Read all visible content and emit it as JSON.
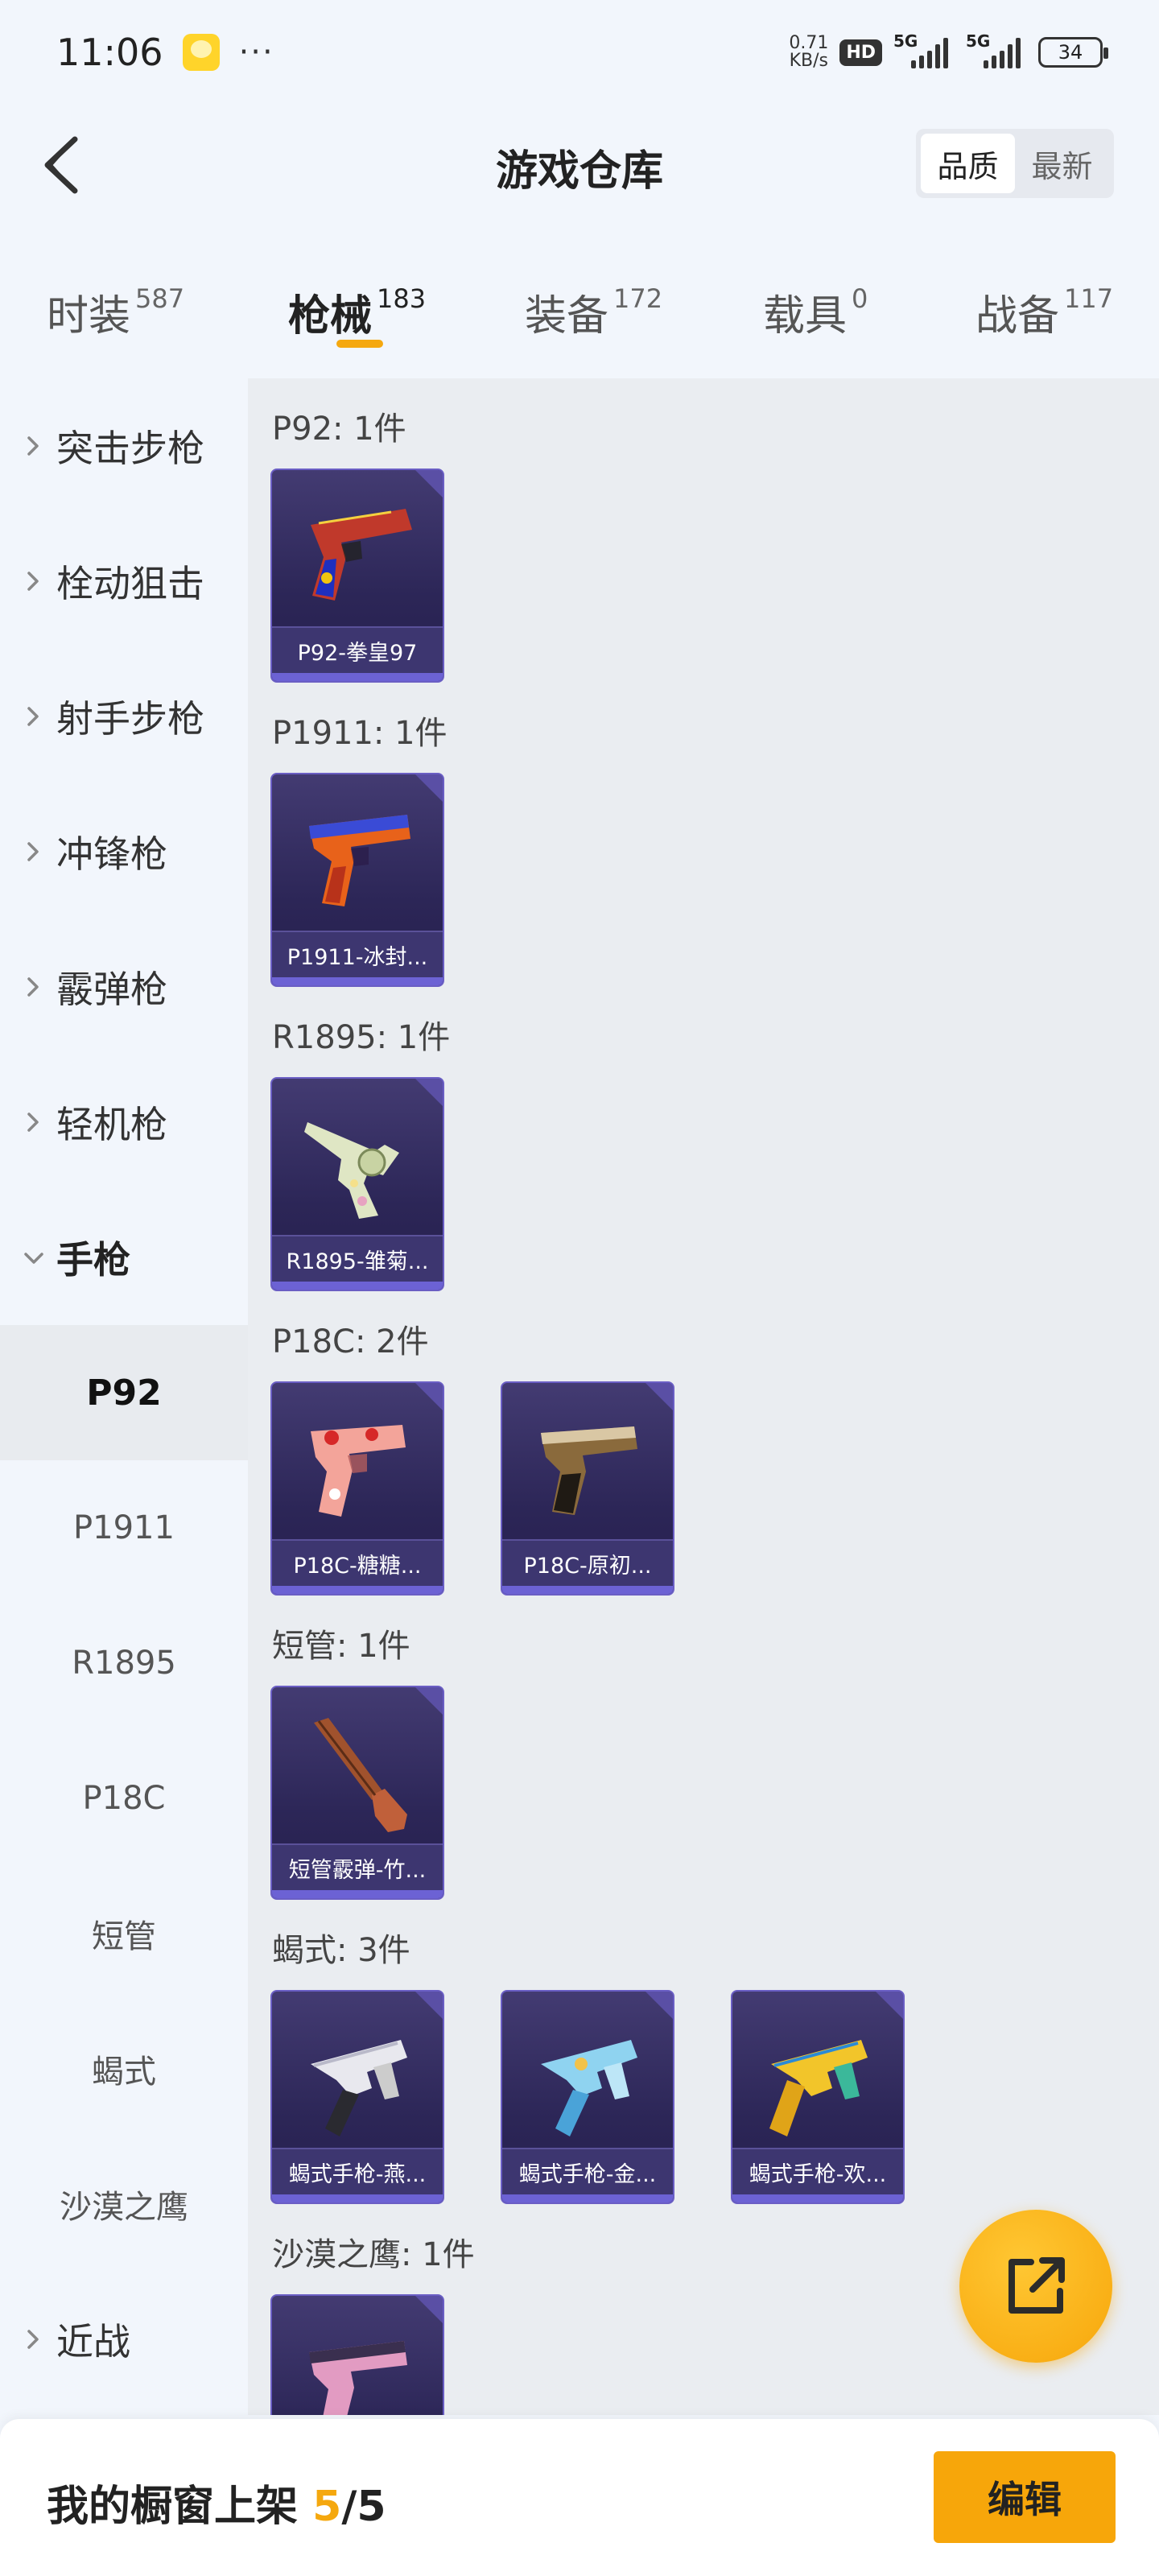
{
  "status_bar": {
    "time": "11:06",
    "more": "···",
    "net_speed_value": "0.71",
    "net_speed_unit": "KB/s",
    "hd": "HD",
    "signal1": "5G",
    "signal2": "5G",
    "battery": "34"
  },
  "header": {
    "title": "游戏仓库",
    "sort_options": [
      "品质",
      "最新"
    ],
    "active_sort": "品质"
  },
  "category_tabs": [
    {
      "label": "时装",
      "count": "587"
    },
    {
      "label": "枪械",
      "count": "183",
      "active": true
    },
    {
      "label": "装备",
      "count": "172"
    },
    {
      "label": "载具",
      "count": "0"
    },
    {
      "label": "战备",
      "count": "117"
    }
  ],
  "sidebar": {
    "groups": [
      "突击步枪",
      "栓动狙击",
      "射手步枪",
      "冲锋枪",
      "霰弹枪",
      "轻机枪",
      "手枪",
      "近战"
    ],
    "expanded_group": "手枪",
    "subitems": [
      "P92",
      "P1911",
      "R1895",
      "P18C",
      "短管",
      "蝎式",
      "沙漠之鹰"
    ],
    "active_subitem": "P92"
  },
  "sections": [
    {
      "title": "P92: 1件",
      "items": [
        "P92-拳皇97"
      ]
    },
    {
      "title": "P1911: 1件",
      "items": [
        "P1911-冰封..."
      ]
    },
    {
      "title": "R1895: 1件",
      "items": [
        "R1895-雏菊..."
      ]
    },
    {
      "title": "P18C: 2件",
      "items": [
        "P18C-糖糖...",
        "P18C-原初..."
      ]
    },
    {
      "title": "短管: 1件",
      "items": [
        "短管霰弹-竹..."
      ]
    },
    {
      "title": "蝎式: 3件",
      "items": [
        "蝎式手枪-燕...",
        "蝎式手枪-金...",
        "蝎式手枪-欢..."
      ]
    },
    {
      "title": "沙漠之鹰: 1件",
      "items": [
        ""
      ]
    }
  ],
  "bottom_bar": {
    "showcase_label": "我的橱窗上架",
    "showcase_current": "5",
    "showcase_sep": "/",
    "showcase_total": "5",
    "edit_label": "编辑"
  },
  "colors": {
    "accent": "#f5a80f",
    "card_bg": "#2c2657",
    "card_border": "#6a5ec4",
    "content_bg": "#eaedf1",
    "sidebar_bg": "#f2f6fc"
  }
}
